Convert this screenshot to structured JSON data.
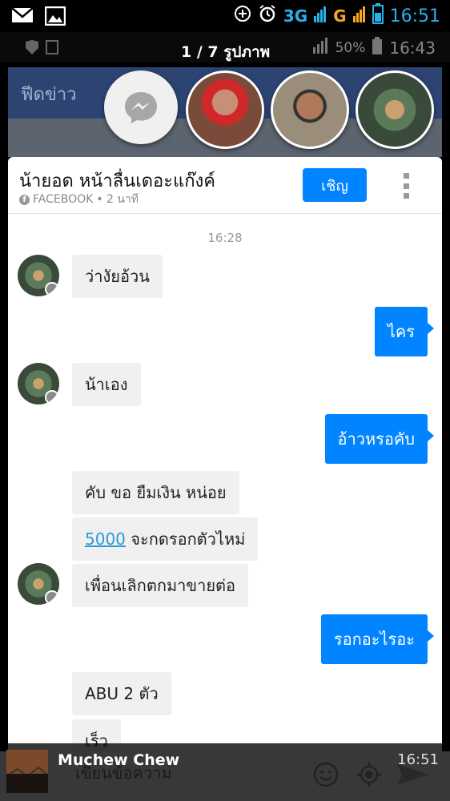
{
  "status_bar": {
    "network_1": "3G",
    "network_2": "G",
    "time": "16:51"
  },
  "viewer": {
    "photo_counter": "1 / 7 รูปภาพ",
    "inner_battery": "50%",
    "inner_time": "16:43"
  },
  "facebook": {
    "header_title": "ฟีดข่าว"
  },
  "chat": {
    "contact_name": "น้ายอด หน้าลื่นเดอะแก๊งค์",
    "source": "FACEBOOK",
    "ago": "• 2 นาที",
    "invite_label": "เชิญ",
    "timestamp": "16:28",
    "messages": [
      {
        "text": "ว่างัยอ้วน"
      },
      {
        "text": "ไคร"
      },
      {
        "text": "น้าเอง"
      },
      {
        "text": "อ้าวหรอคับ"
      },
      {
        "text": "คับ ขอ ยืมเงิน หน่อย"
      },
      {
        "link": "5000",
        "text": " จะกดรอกตัวไหม่"
      },
      {
        "text": "เพื่อนเลิกตกมาขายต่อ"
      },
      {
        "text": "รอกอะไรอะ"
      },
      {
        "text": "ABU 2 ตัว"
      },
      {
        "text": "เร็ว"
      }
    ],
    "input_placeholder": "เขียนข้อความ"
  },
  "notification": {
    "sender": "Muchew Chew",
    "time": "16:51"
  },
  "colors": {
    "accent": "#0084ff",
    "fb_header": "#2d4473"
  }
}
